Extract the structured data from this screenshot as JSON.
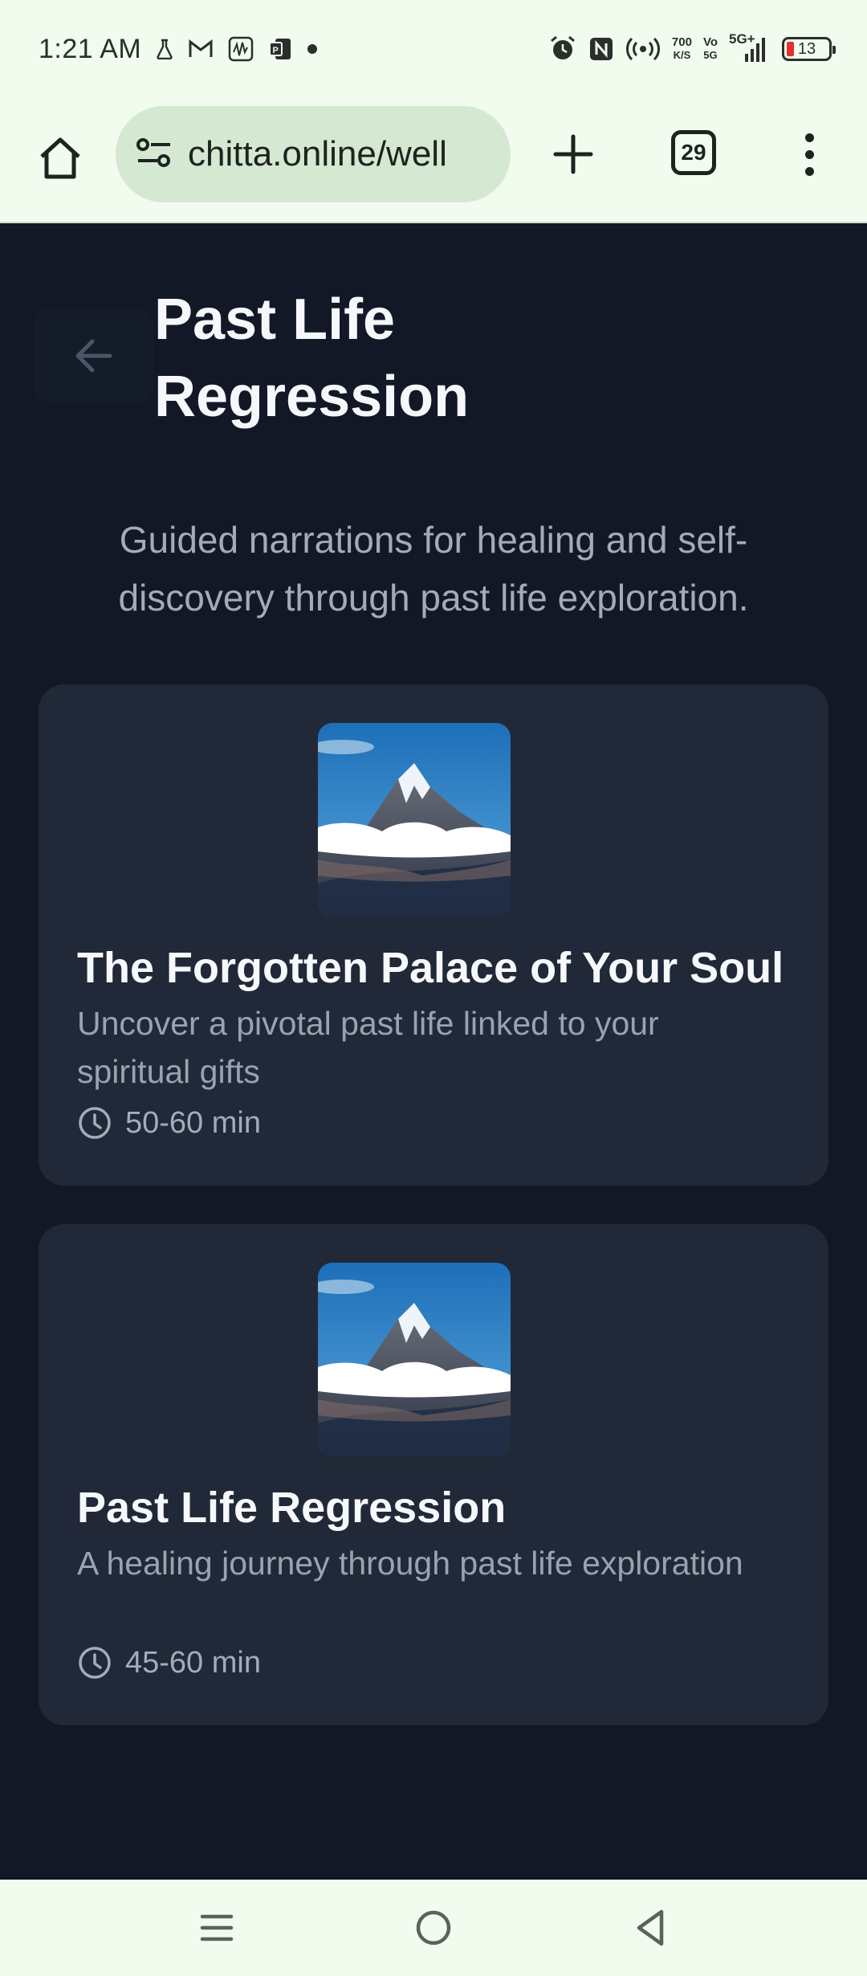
{
  "status_bar": {
    "time": "1:21 AM",
    "network_speed_value": "700",
    "network_speed_unit": "K/S",
    "volte_label": "Vo\n5G",
    "signal_label": "5G+",
    "battery_level": "13"
  },
  "browser": {
    "url": "chitta.online/well",
    "tab_count": "29"
  },
  "page": {
    "title": "Past Life Regression",
    "subtitle": "Guided narrations for healing and self-discovery through past life exploration."
  },
  "cards": [
    {
      "title": "The Forgotten Palace of Your Soul",
      "description": "Uncover a pivotal past life linked to your spiritual gifts",
      "duration": "50-60 min",
      "image": "mountain-peak-image"
    },
    {
      "title": "Past Life Regression",
      "description": "A healing journey through past life exploration",
      "duration": "45-60 min",
      "image": "mountain-peak-image"
    }
  ],
  "colors": {
    "page_background": "#121826",
    "card_background": "#212938",
    "chrome_background": "#f1fbee",
    "url_pill": "#d5e8d2",
    "battery_low": "#e3312f"
  },
  "icons": [
    "home-icon",
    "site-settings-icon",
    "plus-icon",
    "tab-switcher-icon",
    "more-icon",
    "back-arrow-icon",
    "clock-icon",
    "menu-icon",
    "circle-home-icon",
    "back-triangle-icon"
  ]
}
